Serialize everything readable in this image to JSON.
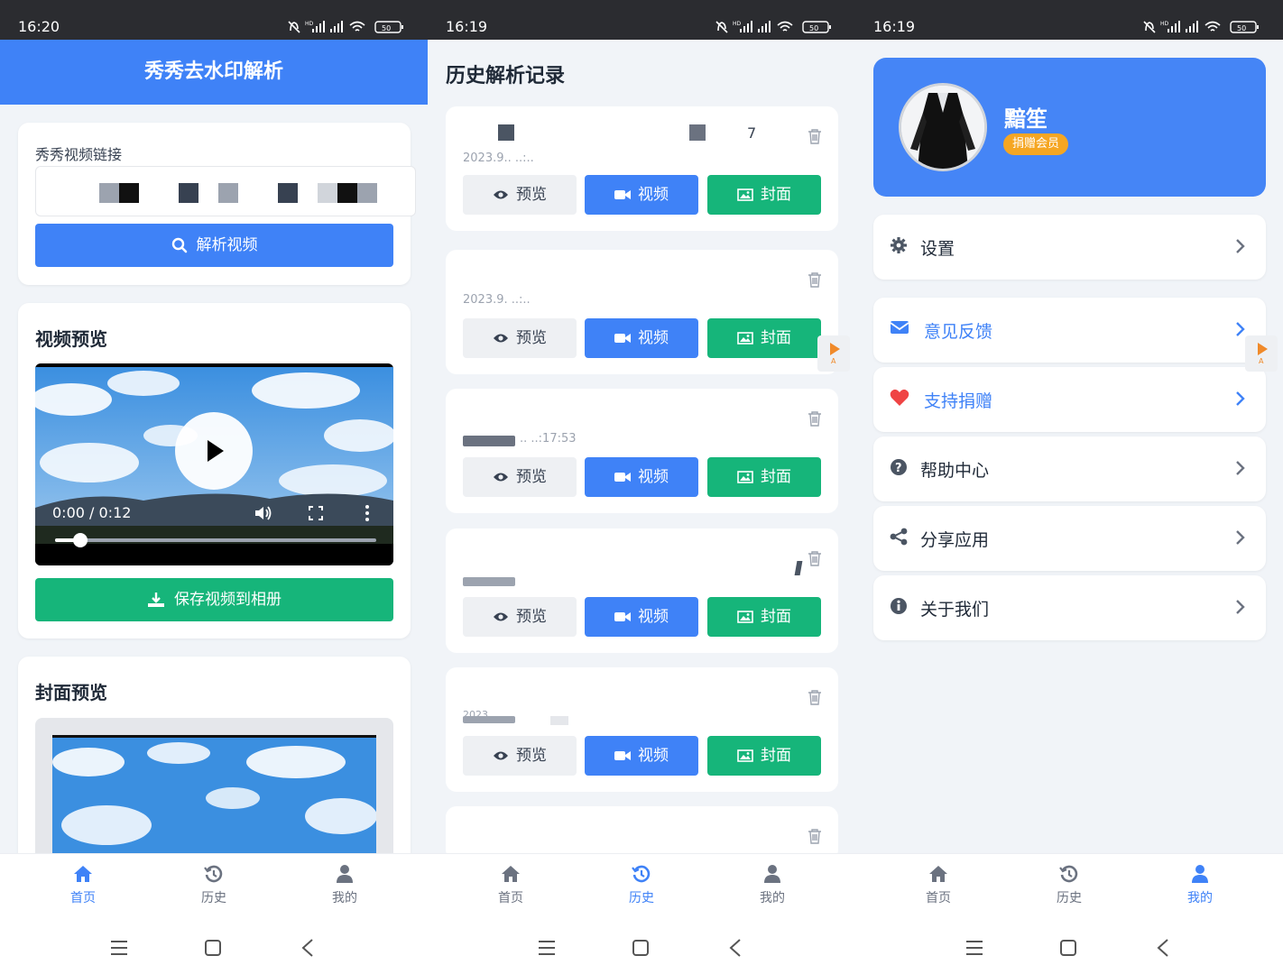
{
  "status_times": [
    "16:20",
    "16:19",
    "16:19"
  ],
  "home": {
    "title": "秀秀去水印解析",
    "link_label": "秀秀视频链接",
    "parse_button": "解析视频",
    "video_preview_title": "视频预览",
    "video_time": "0:00 / 0:12",
    "video_progress": 0.08,
    "save_button": "保存视频到相册",
    "cover_preview_title": "封面预览"
  },
  "history": {
    "title": "历史解析记录",
    "items": [
      {
        "date": "2023.9.. ..:..",
        "count": "7"
      },
      {
        "date": "2023.9. ..:..",
        "count": ""
      },
      {
        "date": ".. ..:17:53",
        "count": ""
      },
      {
        "date": "",
        "count": ""
      },
      {
        "date": "2023",
        "count": ""
      }
    ],
    "preview_label": "预览",
    "video_label": "视频",
    "cover_label": "封面"
  },
  "profile": {
    "username": "黯笙",
    "badge": "捐赠会员",
    "menu": [
      {
        "label": "设置",
        "icon": "gear-icon",
        "color": "#1f2937"
      },
      {
        "label": "意见反馈",
        "icon": "envelope-icon",
        "color": "#3f82f7"
      },
      {
        "label": "支持捐赠",
        "icon": "heart-icon",
        "color": "#3f82f7"
      },
      {
        "label": "帮助中心",
        "icon": "question-circle-icon",
        "color": "#1f2937"
      },
      {
        "label": "分享应用",
        "icon": "share-icon",
        "color": "#1f2937"
      },
      {
        "label": "关于我们",
        "icon": "info-circle-icon",
        "color": "#1f2937"
      }
    ]
  },
  "nav": {
    "home": "首页",
    "history": "历史",
    "mine": "我的"
  },
  "colors": {
    "primary": "#3f82f7",
    "success": "#16b57a",
    "badge": "#f5a623",
    "danger": "#ef4444"
  }
}
